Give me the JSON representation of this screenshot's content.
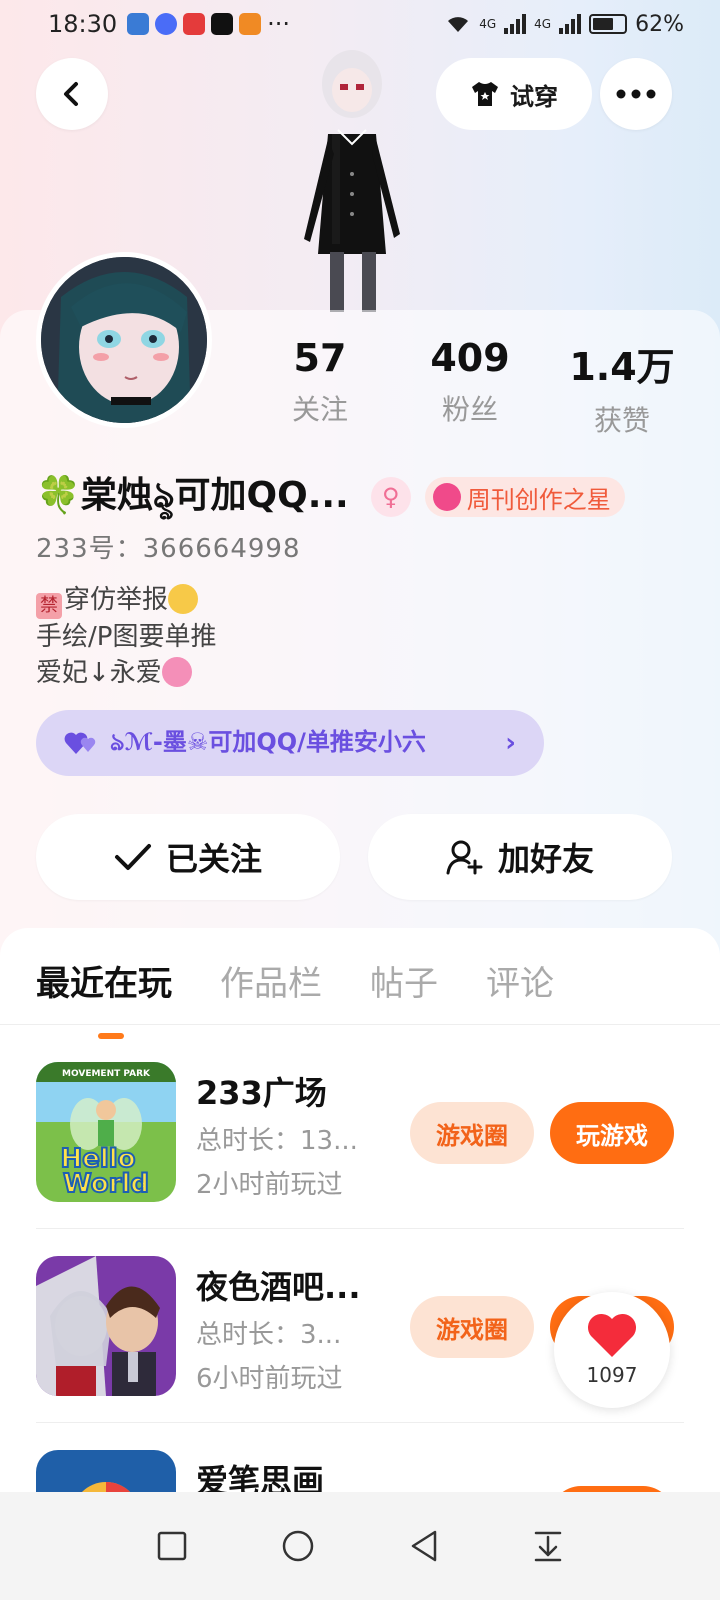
{
  "status_bar": {
    "time": "18:30",
    "more": "···",
    "network_label": "4G",
    "battery": "62%",
    "app_icons": [
      "app-icon-blue",
      "app-icon-music",
      "app-icon-news",
      "app-icon-tiktok",
      "app-icon-video"
    ]
  },
  "header": {
    "back_icon": "chevron-left-icon",
    "try_on_label": "试穿",
    "more_icon": "more-dots-icon"
  },
  "profile": {
    "stats": [
      {
        "value": "57",
        "label": "关注"
      },
      {
        "value": "409",
        "label": "粉丝"
      },
      {
        "value": "1.4万",
        "label": "获赞"
      }
    ],
    "name": "🍀棠烛ৡ可加QQ...",
    "gender_symbol": "♀",
    "creator_badge": "周刊创作之星",
    "uid": "233号：366664998",
    "bio": {
      "line1_badge": "禁",
      "line1_text": "穿仿举报",
      "line2": "手绘/P图要单推",
      "line3": "爱妃↓永爱"
    },
    "partner_label": "ঌℳ-墨☠可加QQ/单推安小六",
    "follow_label": "已关注",
    "add_friend_label": "加好友"
  },
  "tabs": [
    "最近在玩",
    "作品栏",
    "帖子",
    "评论"
  ],
  "games": [
    {
      "title": "233广场",
      "duration": "总时长：13...",
      "last_played": "2小时前玩过",
      "circle_label": "游戏圈",
      "play_label": "玩游戏",
      "icon_text_1": "Hello",
      "icon_text_2": "World",
      "icon_banner": "MOVEMENT PARK"
    },
    {
      "title": "夜色酒吧...",
      "duration": "总时长：3...",
      "last_played": "6小时前玩过",
      "circle_label": "游戏圈",
      "play_label": "玩游戏"
    },
    {
      "title": "爱笔思画"
    }
  ],
  "like_float": {
    "count": "1097"
  },
  "colors": {
    "accent": "#ff6d12",
    "circle_bg": "#fde3d3",
    "partner_bg": "#dcd6f6",
    "partner_text": "#6a4fe0"
  }
}
